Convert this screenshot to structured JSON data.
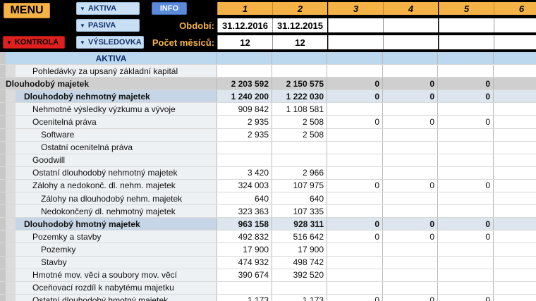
{
  "toolbar": {
    "menu_label": "MENU",
    "aktiva_label": "AKTIVA",
    "info_label": "INFO",
    "pasiva_label": "PASIVA",
    "kontrola_label": "KONTROLA",
    "vysledovka_label": "VÝSLEDOVKA",
    "triangle": "▼"
  },
  "colors": {
    "orange": "#f5b347",
    "red": "#e0201f",
    "light_blue": "#c9e0f4",
    "info_blue": "#5b8ad8"
  },
  "header": {
    "columns": [
      "1",
      "2",
      "3",
      "4",
      "5",
      "6"
    ],
    "obdobi_label": "Období:",
    "obdobi": [
      "31.12.2016",
      "31.12.2015",
      "",
      "",
      "",
      ""
    ],
    "mesicu_label": "Počet měsíců:",
    "mesicu": [
      "12",
      "12",
      "",
      "",
      "",
      ""
    ]
  },
  "rows": [
    {
      "label": "AKTIVA",
      "level": "section",
      "values": [
        "",
        "",
        "",
        "",
        "",
        ""
      ]
    },
    {
      "label": "Pohledávky za upsaný základní kapitál",
      "level": "l2",
      "values": [
        "",
        "",
        "",
        "",
        "",
        ""
      ]
    },
    {
      "label": "Dlouhodobý majetek",
      "level": "l0",
      "values": [
        "2 203 592",
        "2 150 575",
        "0",
        "0",
        "0",
        ""
      ]
    },
    {
      "label": "Dlouhodobý nehmotný majetek",
      "level": "l1",
      "values": [
        "1 240 200",
        "1 222 030",
        "0",
        "0",
        "0",
        ""
      ]
    },
    {
      "label": "Nehmotné výsledky výzkumu a vývoje",
      "level": "l2",
      "values": [
        "909 842",
        "1 108 581",
        "",
        "",
        "",
        ""
      ]
    },
    {
      "label": "Ocenitelná práva",
      "level": "l2",
      "values": [
        "2 935",
        "2 508",
        "0",
        "0",
        "0",
        ""
      ]
    },
    {
      "label": "Software",
      "level": "l3",
      "values": [
        "2 935",
        "2 508",
        "",
        "",
        "",
        ""
      ]
    },
    {
      "label": "Ostatní ocenitelná práva",
      "level": "l3",
      "values": [
        "",
        "",
        "",
        "",
        "",
        ""
      ]
    },
    {
      "label": "Goodwill",
      "level": "l2",
      "values": [
        "",
        "",
        "",
        "",
        "",
        ""
      ]
    },
    {
      "label": "Ostatní dlouhodobý nehmotný majetek",
      "level": "l2",
      "values": [
        "3 420",
        "2 966",
        "",
        "",
        "",
        ""
      ]
    },
    {
      "label": "Zálohy a nedokonč. dl. nehm. majetek",
      "level": "l2",
      "values": [
        "324 003",
        "107 975",
        "0",
        "0",
        "0",
        ""
      ]
    },
    {
      "label": "Zálohy na dlouhodobý nehm. majetek",
      "level": "l3",
      "values": [
        "640",
        "640",
        "",
        "",
        "",
        ""
      ]
    },
    {
      "label": "Nedokončený dl. nehmotný majetek",
      "level": "l3",
      "values": [
        "323 363",
        "107 335",
        "",
        "",
        "",
        ""
      ]
    },
    {
      "label": "Dlouhodobý hmotný majetek",
      "level": "l1",
      "values": [
        "963 158",
        "928 311",
        "0",
        "0",
        "0",
        ""
      ]
    },
    {
      "label": "Pozemky a stavby",
      "level": "l2",
      "values": [
        "492 832",
        "516 642",
        "0",
        "0",
        "0",
        ""
      ]
    },
    {
      "label": "Pozemky",
      "level": "l3",
      "values": [
        "17 900",
        "17 900",
        "",
        "",
        "",
        ""
      ]
    },
    {
      "label": "Stavby",
      "level": "l3",
      "values": [
        "474 932",
        "498 742",
        "",
        "",
        "",
        ""
      ]
    },
    {
      "label": "Hmotné mov. věci a soubory mov. věcí",
      "level": "l2",
      "values": [
        "390 674",
        "392 520",
        "",
        "",
        "",
        ""
      ]
    },
    {
      "label": "Oceňovací rozdíl k nabytému majetku",
      "level": "l2",
      "values": [
        "",
        "",
        "",
        "",
        "",
        ""
      ]
    },
    {
      "label": "Ostatní dlouhodobý hmotný majetek",
      "level": "l2",
      "values": [
        "1 173",
        "1 173",
        "0",
        "0",
        "0",
        ""
      ]
    }
  ]
}
